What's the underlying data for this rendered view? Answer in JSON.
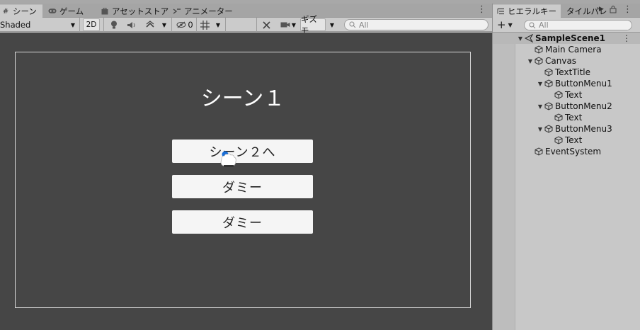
{
  "scene_tabs": [
    {
      "label": "シーン",
      "icon": "grid-icon",
      "active": true
    },
    {
      "label": "ゲーム",
      "icon": "gamepad-icon",
      "active": false
    },
    {
      "label": "アセットストア",
      "icon": "bag-icon",
      "active": false
    },
    {
      "label": "アニメーター",
      "icon": "animator-icon",
      "active": false
    }
  ],
  "scene_toolbar": {
    "shading_mode": "Shaded",
    "mode_2d": "2D",
    "hidden_count": "0",
    "gizmos": "ギズモ",
    "search_placeholder": "All"
  },
  "scene_view": {
    "title": "シーン１",
    "buttons": [
      "シーン２へ",
      "ダミー",
      "ダミー"
    ]
  },
  "hierarchy_tabs": [
    {
      "label": "ヒエラルキー",
      "active": true
    },
    {
      "label": "タイルパレ",
      "active": false
    }
  ],
  "hierarchy_toolbar": {
    "add_label": "+",
    "search_placeholder": "All"
  },
  "hierarchy": [
    {
      "name": "SampleScene1",
      "depth": 0,
      "expanded": true,
      "root": true
    },
    {
      "name": "Main Camera",
      "depth": 1,
      "expanded": null
    },
    {
      "name": "Canvas",
      "depth": 1,
      "expanded": true
    },
    {
      "name": "TextTitle",
      "depth": 2,
      "expanded": null
    },
    {
      "name": "ButtonMenu1",
      "depth": 2,
      "expanded": true
    },
    {
      "name": "Text",
      "depth": 3,
      "expanded": null
    },
    {
      "name": "ButtonMenu2",
      "depth": 2,
      "expanded": true
    },
    {
      "name": "Text",
      "depth": 3,
      "expanded": null
    },
    {
      "name": "ButtonMenu3",
      "depth": 2,
      "expanded": true
    },
    {
      "name": "Text",
      "depth": 3,
      "expanded": null
    },
    {
      "name": "EventSystem",
      "depth": 1,
      "expanded": null
    }
  ],
  "colors": {
    "viewport_bg": "#464646",
    "scene_title": "#ffffff",
    "button_bg": "#f5f5f5",
    "cursor_accent": "#1a6fd8"
  }
}
